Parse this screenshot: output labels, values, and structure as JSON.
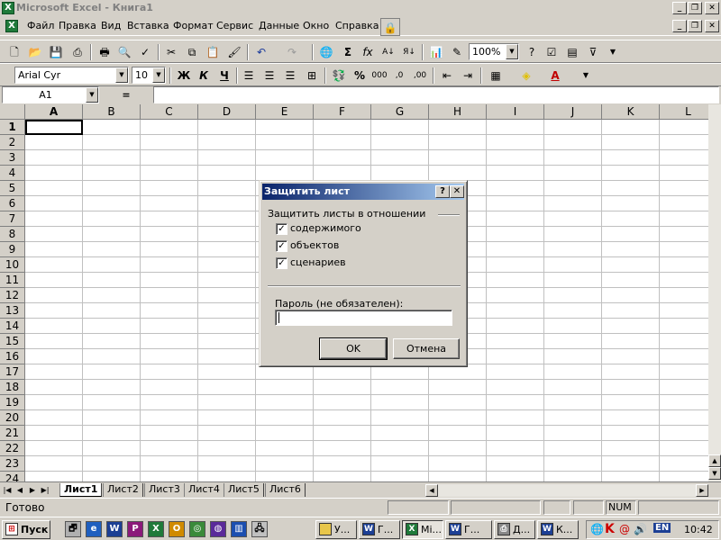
{
  "window": {
    "title": "Microsoft Excel - Книга1",
    "app_icon": "excel-icon",
    "controls": [
      "minimize-icon",
      "maximize-icon",
      "close-icon"
    ]
  },
  "menu": [
    "Файл",
    "Правка",
    "Вид",
    "Вставка",
    "Формат",
    "Сервис",
    "Данные",
    "Окно",
    "Справка"
  ],
  "toolbar": {
    "zoom": "100%"
  },
  "format": {
    "font": "Arial Cyr",
    "size": "10",
    "bold": "Ж",
    "italic": "К",
    "underline": "Ч",
    "percent": "%",
    "thousands": "000"
  },
  "formula": {
    "namebox": "A1",
    "equals": "="
  },
  "grid": {
    "columns": [
      "A",
      "B",
      "C",
      "D",
      "E",
      "F",
      "G",
      "H",
      "I",
      "J",
      "K",
      "L"
    ],
    "rows": [
      "1",
      "2",
      "3",
      "4",
      "5",
      "6",
      "7",
      "8",
      "9",
      "10",
      "11",
      "12",
      "13",
      "14",
      "15",
      "16",
      "17",
      "18",
      "19",
      "20",
      "21",
      "22",
      "23",
      "24"
    ],
    "active_cell": "A1"
  },
  "sheets": {
    "tabs": [
      "Лист1",
      "Лист2",
      "Лист3",
      "Лист4",
      "Лист5",
      "Лист6"
    ],
    "active": "Лист1"
  },
  "status": {
    "text": "Готово",
    "num": "NUM"
  },
  "dialog": {
    "title": "Защитить лист",
    "help": "?",
    "close": "✕",
    "group_label": "Защитить листы в отношении",
    "options": [
      {
        "label": "содержимого",
        "checked": true
      },
      {
        "label": "объектов",
        "checked": true
      },
      {
        "label": "сценариев",
        "checked": true
      }
    ],
    "password_label": "Пароль (не обязателен):",
    "password_value": "",
    "ok": "OK",
    "cancel": "Отмена"
  },
  "taskbar": {
    "start": "Пуск",
    "tasks": [
      {
        "label": "У...",
        "icon": "folder-icon"
      },
      {
        "label": "Г...",
        "icon": "word-icon"
      },
      {
        "label": "Mi...",
        "icon": "excel-icon",
        "active": true
      },
      {
        "label": "Г...",
        "icon": "word-icon"
      },
      {
        "label": "Д...",
        "icon": "printer-icon"
      },
      {
        "label": "К...",
        "icon": "word-icon"
      }
    ],
    "lang": "EN",
    "clock": "10:42"
  }
}
